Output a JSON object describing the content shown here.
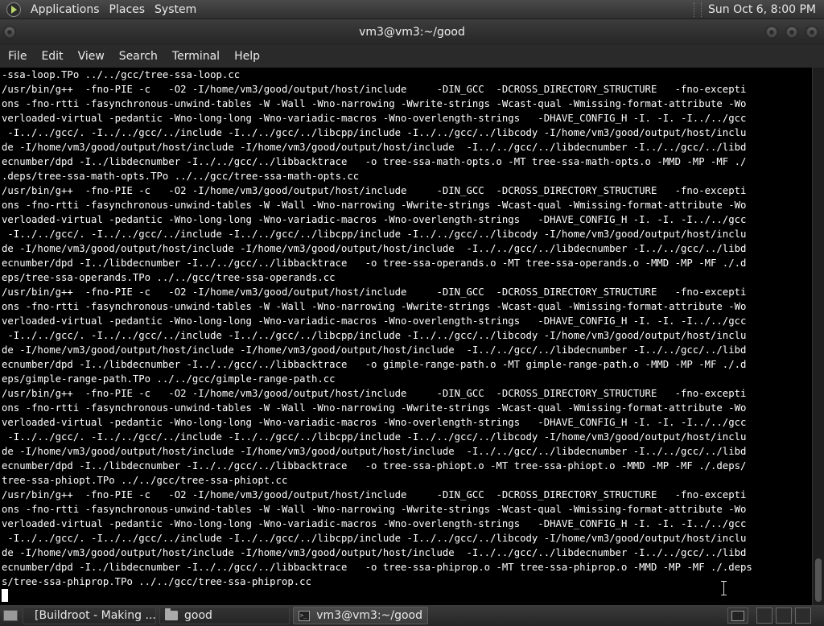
{
  "top_panel": {
    "menus": [
      "Applications",
      "Places",
      "System"
    ],
    "clock": "Sun Oct  6,  8:00 PM"
  },
  "window": {
    "title": "vm3@vm3:~/good"
  },
  "menubar": {
    "items": [
      "File",
      "Edit",
      "View",
      "Search",
      "Terminal",
      "Help"
    ]
  },
  "terminal": {
    "lines": [
      "-ssa-loop.TPo ../../gcc/tree-ssa-loop.cc",
      "/usr/bin/g++  -fno-PIE -c   -O2 -I/home/vm3/good/output/host/include     -DIN_GCC  -DCROSS_DIRECTORY_STRUCTURE   -fno-excepti",
      "ons -fno-rtti -fasynchronous-unwind-tables -W -Wall -Wno-narrowing -Wwrite-strings -Wcast-qual -Wmissing-format-attribute -Wo",
      "verloaded-virtual -pedantic -Wno-long-long -Wno-variadic-macros -Wno-overlength-strings   -DHAVE_CONFIG_H -I. -I. -I../../gcc",
      " -I../../gcc/. -I../../gcc/../include -I../../gcc/../libcpp/include -I../../gcc/../libcody -I/home/vm3/good/output/host/inclu",
      "de -I/home/vm3/good/output/host/include -I/home/vm3/good/output/host/include  -I../../gcc/../libdecnumber -I../../gcc/../libd",
      "ecnumber/dpd -I../libdecnumber -I../../gcc/../libbacktrace   -o tree-ssa-math-opts.o -MT tree-ssa-math-opts.o -MMD -MP -MF ./",
      ".deps/tree-ssa-math-opts.TPo ../../gcc/tree-ssa-math-opts.cc",
      "/usr/bin/g++  -fno-PIE -c   -O2 -I/home/vm3/good/output/host/include     -DIN_GCC  -DCROSS_DIRECTORY_STRUCTURE   -fno-excepti",
      "ons -fno-rtti -fasynchronous-unwind-tables -W -Wall -Wno-narrowing -Wwrite-strings -Wcast-qual -Wmissing-format-attribute -Wo",
      "verloaded-virtual -pedantic -Wno-long-long -Wno-variadic-macros -Wno-overlength-strings   -DHAVE_CONFIG_H -I. -I. -I../../gcc",
      " -I../../gcc/. -I../../gcc/../include -I../../gcc/../libcpp/include -I../../gcc/../libcody -I/home/vm3/good/output/host/inclu",
      "de -I/home/vm3/good/output/host/include -I/home/vm3/good/output/host/include  -I../../gcc/../libdecnumber -I../../gcc/../libd",
      "ecnumber/dpd -I../libdecnumber -I../../gcc/../libbacktrace   -o tree-ssa-operands.o -MT tree-ssa-operands.o -MMD -MP -MF ./.d",
      "eps/tree-ssa-operands.TPo ../../gcc/tree-ssa-operands.cc",
      "/usr/bin/g++  -fno-PIE -c   -O2 -I/home/vm3/good/output/host/include     -DIN_GCC  -DCROSS_DIRECTORY_STRUCTURE   -fno-excepti",
      "ons -fno-rtti -fasynchronous-unwind-tables -W -Wall -Wno-narrowing -Wwrite-strings -Wcast-qual -Wmissing-format-attribute -Wo",
      "verloaded-virtual -pedantic -Wno-long-long -Wno-variadic-macros -Wno-overlength-strings   -DHAVE_CONFIG_H -I. -I. -I../../gcc",
      " -I../../gcc/. -I../../gcc/../include -I../../gcc/../libcpp/include -I../../gcc/../libcody -I/home/vm3/good/output/host/inclu",
      "de -I/home/vm3/good/output/host/include -I/home/vm3/good/output/host/include  -I../../gcc/../libdecnumber -I../../gcc/../libd",
      "ecnumber/dpd -I../libdecnumber -I../../gcc/../libbacktrace   -o gimple-range-path.o -MT gimple-range-path.o -MMD -MP -MF ./.d",
      "eps/gimple-range-path.TPo ../../gcc/gimple-range-path.cc",
      "/usr/bin/g++  -fno-PIE -c   -O2 -I/home/vm3/good/output/host/include     -DIN_GCC  -DCROSS_DIRECTORY_STRUCTURE   -fno-excepti",
      "ons -fno-rtti -fasynchronous-unwind-tables -W -Wall -Wno-narrowing -Wwrite-strings -Wcast-qual -Wmissing-format-attribute -Wo",
      "verloaded-virtual -pedantic -Wno-long-long -Wno-variadic-macros -Wno-overlength-strings   -DHAVE_CONFIG_H -I. -I. -I../../gcc",
      " -I../../gcc/. -I../../gcc/../include -I../../gcc/../libcpp/include -I../../gcc/../libcody -I/home/vm3/good/output/host/inclu",
      "de -I/home/vm3/good/output/host/include -I/home/vm3/good/output/host/include  -I../../gcc/../libdecnumber -I../../gcc/../libd",
      "ecnumber/dpd -I../libdecnumber -I../../gcc/../libbacktrace   -o tree-ssa-phiopt.o -MT tree-ssa-phiopt.o -MMD -MP -MF ./.deps/",
      "tree-ssa-phiopt.TPo ../../gcc/tree-ssa-phiopt.cc",
      "/usr/bin/g++  -fno-PIE -c   -O2 -I/home/vm3/good/output/host/include     -DIN_GCC  -DCROSS_DIRECTORY_STRUCTURE   -fno-excepti",
      "ons -fno-rtti -fasynchronous-unwind-tables -W -Wall -Wno-narrowing -Wwrite-strings -Wcast-qual -Wmissing-format-attribute -Wo",
      "verloaded-virtual -pedantic -Wno-long-long -Wno-variadic-macros -Wno-overlength-strings   -DHAVE_CONFIG_H -I. -I. -I../../gcc",
      " -I../../gcc/. -I../../gcc/../include -I../../gcc/../libcpp/include -I../../gcc/../libcody -I/home/vm3/good/output/host/inclu",
      "de -I/home/vm3/good/output/host/include -I/home/vm3/good/output/host/include  -I../../gcc/../libdecnumber -I../../gcc/../libd",
      "ecnumber/dpd -I../libdecnumber -I../../gcc/../libbacktrace   -o tree-ssa-phiprop.o -MT tree-ssa-phiprop.o -MMD -MP -MF ./.deps",
      "s/tree-ssa-phiprop.TPo ../../gcc/tree-ssa-phiprop.cc"
    ]
  },
  "taskbar": {
    "tasks": [
      {
        "label": "[Buildroot - Making ...",
        "icon": "firefox-icon"
      },
      {
        "label": "good",
        "icon": "folder-icon"
      },
      {
        "label": "vm3@vm3:~/good",
        "icon": "terminal-icon"
      }
    ]
  }
}
